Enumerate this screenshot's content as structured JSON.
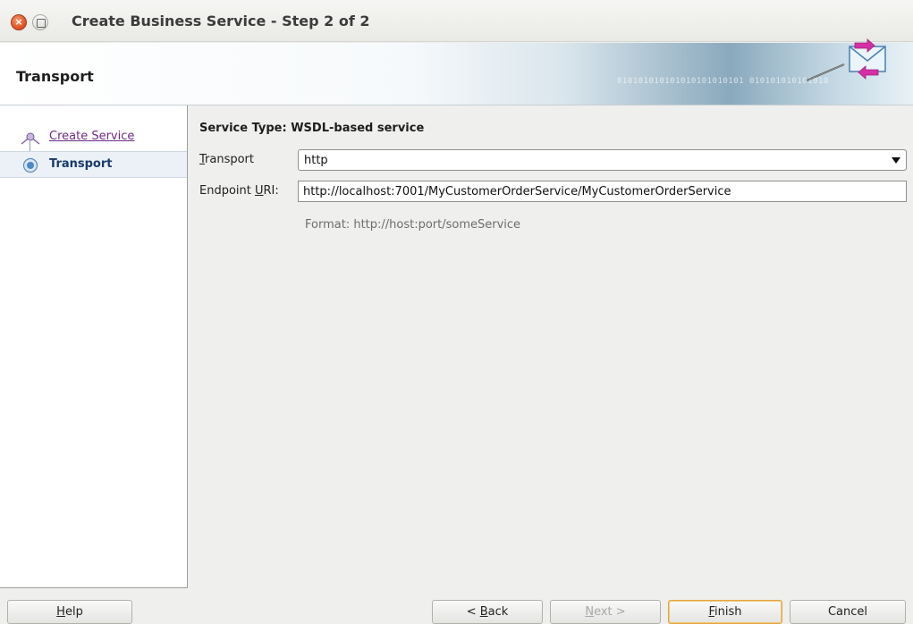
{
  "window": {
    "title": "Create Business Service - Step 2 of 2",
    "close_glyph": "×"
  },
  "header": {
    "title": "Transport",
    "binary_text": "010101010101010101010101  010101010101010",
    "icon": "transport-envelope-icon"
  },
  "sidebar": {
    "items": [
      {
        "label": "Create Service",
        "state": "visited",
        "icon": "step-node-icon"
      },
      {
        "label": "Transport",
        "state": "current",
        "icon": "current-step-icon"
      }
    ]
  },
  "main": {
    "service_type": "Service Type: WSDL-based service",
    "transport": {
      "label_mnemonic": "T",
      "label_rest": "ransport",
      "value": "http"
    },
    "endpoint": {
      "label_pre": "Endpoint ",
      "label_mnemonic": "U",
      "label_post": "RI:",
      "value": "http://localhost:7001/MyCustomerOrderService/MyCustomerOrderService"
    },
    "format_hint": "Format:  http://host:port/someService"
  },
  "buttons": {
    "help": {
      "mnemonic": "H",
      "rest": "elp"
    },
    "back": {
      "pre": "< ",
      "mnemonic": "B",
      "rest": "ack"
    },
    "next": {
      "mnemonic": "N",
      "rest": "ext >"
    },
    "finish": {
      "mnemonic": "F",
      "rest": "inish"
    },
    "cancel": {
      "label": "Cancel"
    }
  },
  "colors": {
    "link": "#6c2a86",
    "active_step": "#1a3a6b",
    "focus_border": "#e1a545"
  }
}
